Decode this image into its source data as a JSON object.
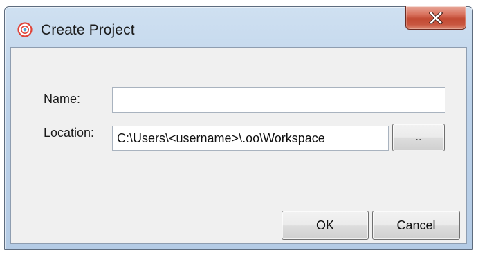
{
  "window": {
    "title": "Create Project",
    "icon": "app-logo-icon",
    "close_icon": "close-icon"
  },
  "form": {
    "name_label": "Name:",
    "name_value": "",
    "location_label": "Location:",
    "location_value": "C:\\Users\\<username>\\.oo\\Workspace",
    "browse_label": ".."
  },
  "buttons": {
    "ok_label": "OK",
    "cancel_label": "Cancel"
  },
  "colors": {
    "titlebar": "#c4d8ee",
    "close_button": "#c9503a",
    "client_background": "#f0f0f0",
    "app_icon_accent": "#e0443a"
  }
}
